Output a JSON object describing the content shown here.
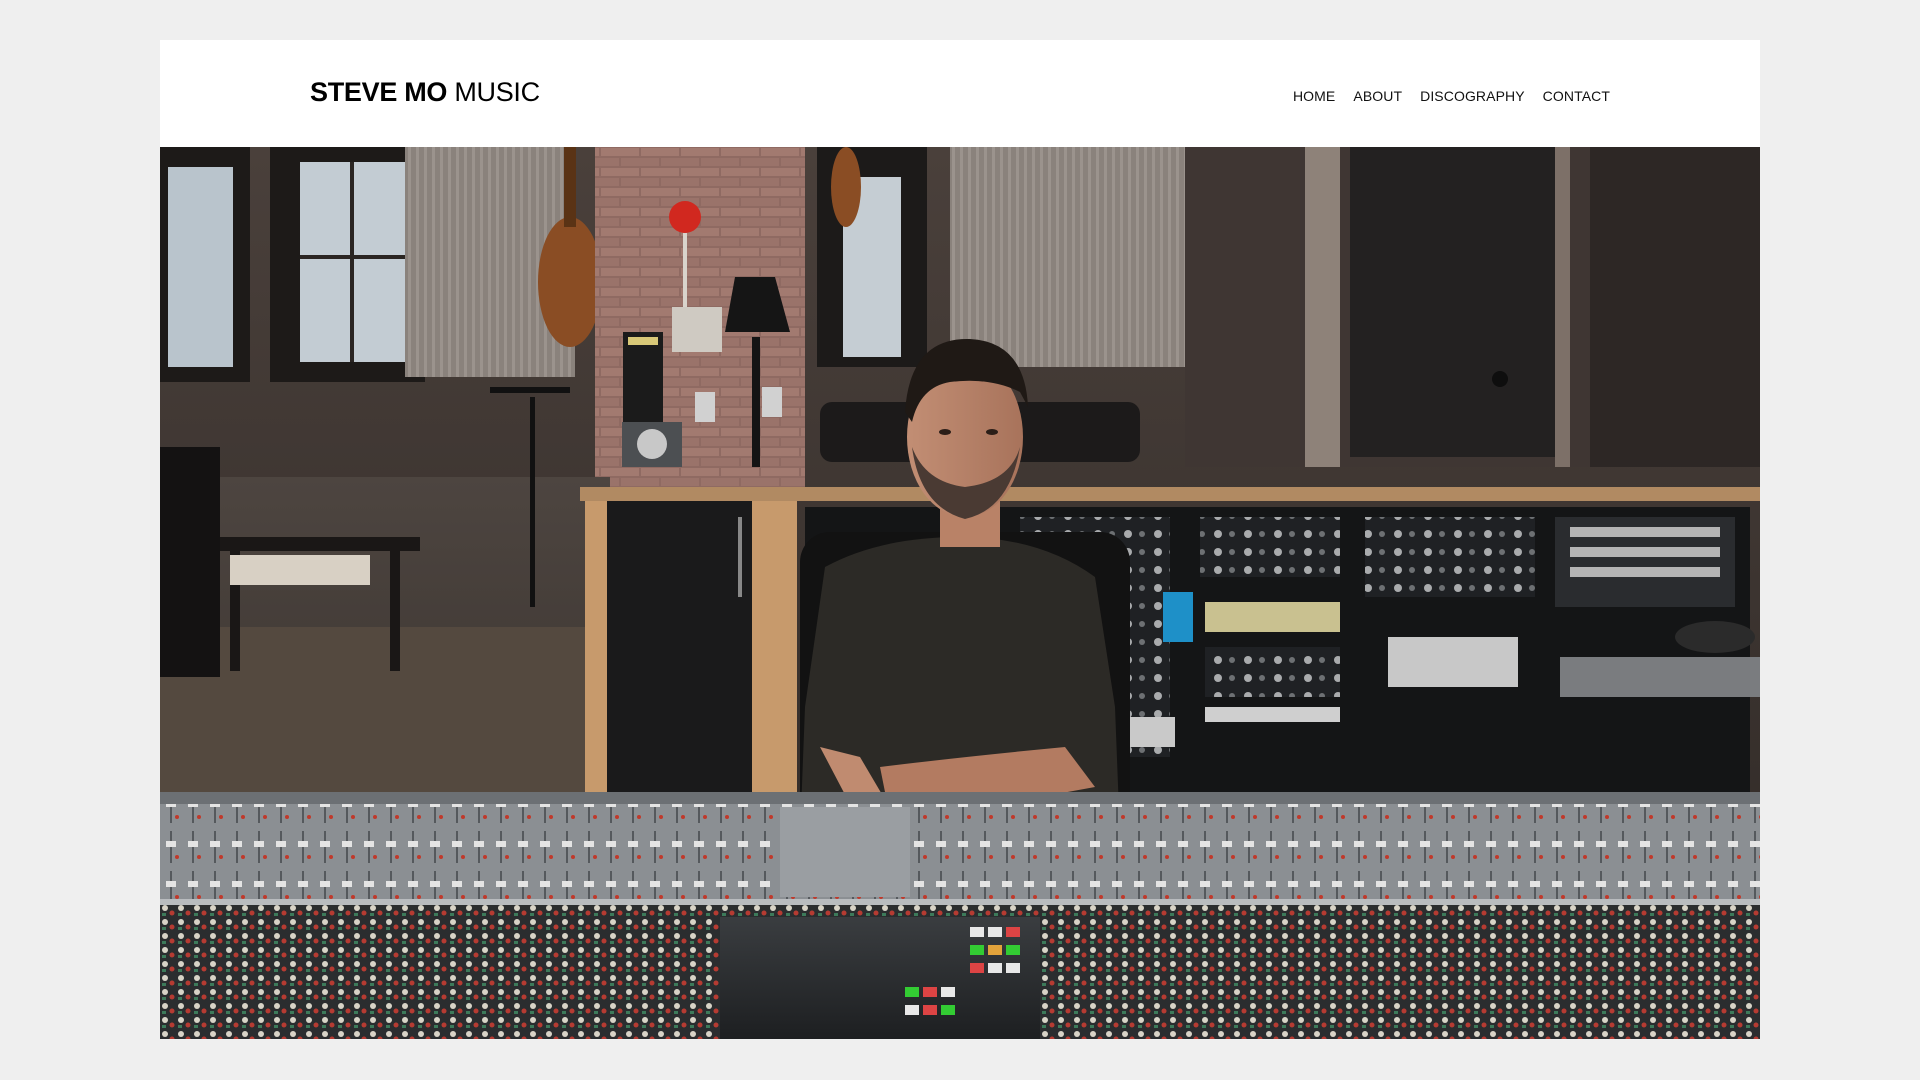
{
  "site": {
    "logo_bold": "STEVE MO",
    "logo_light": " MUSIC"
  },
  "nav": {
    "items": [
      {
        "label": "HOME"
      },
      {
        "label": "ABOUT"
      },
      {
        "label": "DISCOGRAPHY"
      },
      {
        "label": "CONTACT"
      }
    ]
  },
  "hero": {
    "subject": "Musician seated at a large mixing console in a recording studio"
  }
}
